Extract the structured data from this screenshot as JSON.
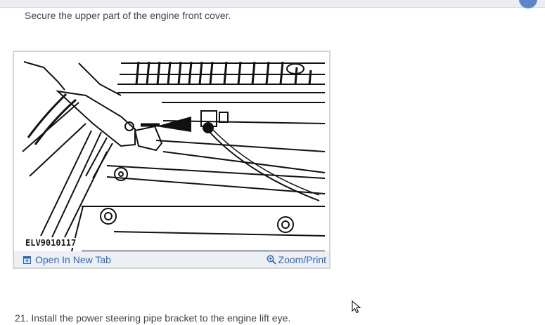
{
  "step_intro": "Secure the upper part of the engine front cover.",
  "figure": {
    "code": "ELV9010117",
    "open_tab_label": "Open In New Tab",
    "zoom_label": "Zoom/Print",
    "icons": {
      "open_tab": "open-in-new-tab-icon",
      "zoom": "zoom-in-icon"
    }
  },
  "step_next": "21. Install the power steering pipe bracket to the engine lift eye.",
  "colors": {
    "link": "#2a68c0",
    "footer_bg": "#eceff3",
    "card_border": "#d3d5d8",
    "text": "#444444"
  }
}
